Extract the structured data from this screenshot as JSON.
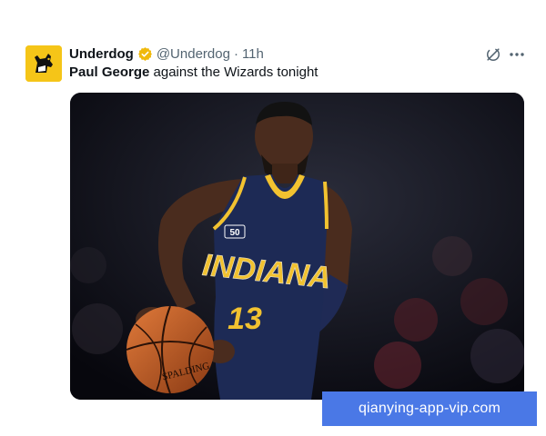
{
  "tweet": {
    "display_name": "Underdog",
    "handle": "@Underdog",
    "separator": "·",
    "time": "11h",
    "text_bold": "Paul George",
    "text_rest": " against the Wizards tonight"
  },
  "media": {
    "jersey_team": "INDIANA",
    "jersey_number": "13",
    "patch": "50",
    "ball_brand": "SPALDING"
  },
  "watermark": "qianying-app-vip.com",
  "colors": {
    "avatar_bg": "#f5c518",
    "verified": "#f0b90b",
    "jersey": "#1d2a55",
    "jersey_trim": "#f2c230",
    "watermark_bg": "#4a78e6"
  },
  "icons": {
    "avatar": "dog-logo-icon",
    "verified": "verified-badge-icon",
    "grok": "grok-icon",
    "more": "more-horizontal-icon"
  }
}
